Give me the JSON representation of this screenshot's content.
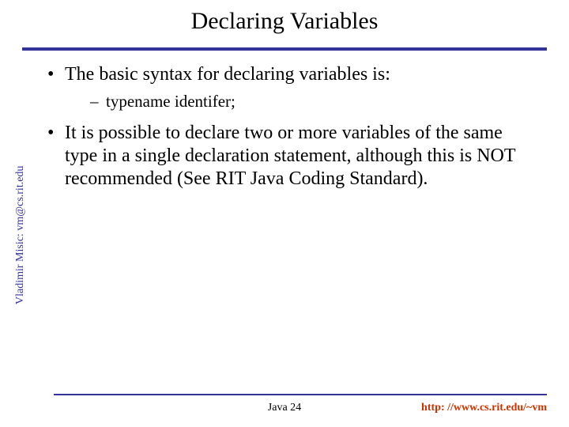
{
  "slide": {
    "title": "Declaring Variables",
    "bullets": [
      {
        "text": "The basic syntax for declaring variables is:",
        "sub": [
          "typename identifer;"
        ]
      },
      {
        "text": "It is possible to declare two or more variables of the same type in a single declaration statement, although this is NOT recommended (See RIT Java Coding Standard).",
        "sub": []
      }
    ],
    "sidetext": "Vladimir Misic: vm@cs.rit.edu",
    "footer_center": "Java 24",
    "footer_right": "http: //www.cs.rit.edu/~vm"
  }
}
